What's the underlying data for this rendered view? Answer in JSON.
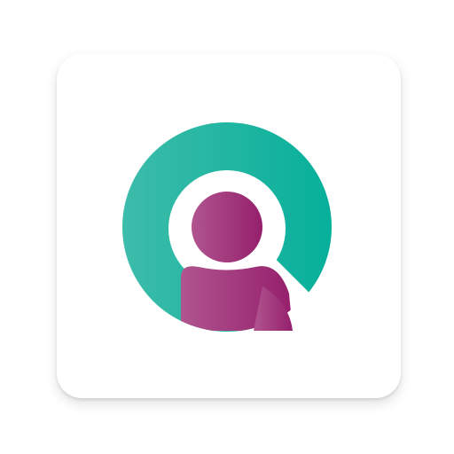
{
  "app_icon": {
    "icon": "person-search-logo-icon",
    "colors": {
      "tile": "#ffffff",
      "ring_start": "#3dbcaa",
      "ring_end": "#06b09a",
      "person_start": "#b0558f",
      "person_end": "#951f6c"
    }
  }
}
